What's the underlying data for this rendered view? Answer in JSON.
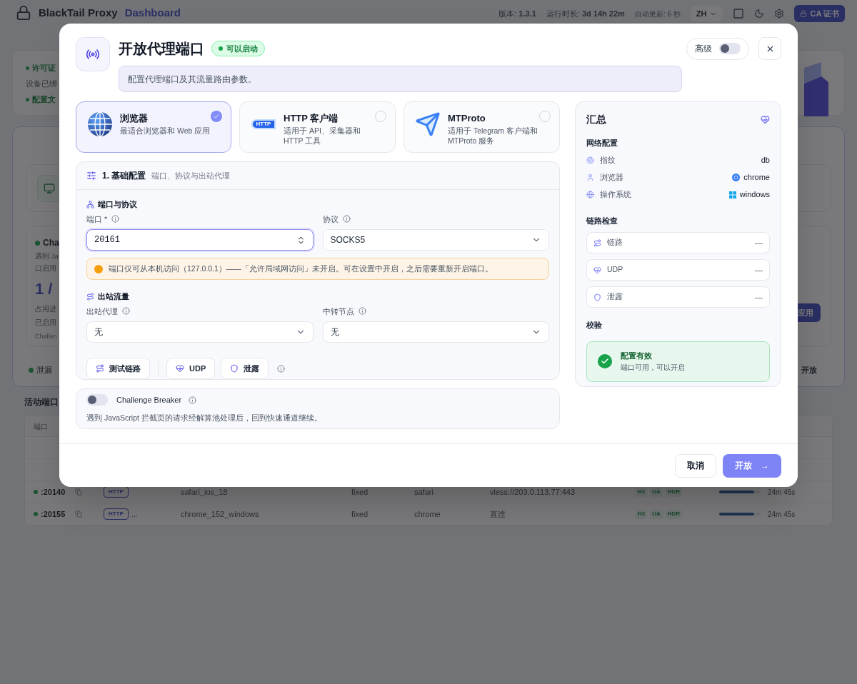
{
  "app_header": {
    "title": "BlackTail Proxy",
    "subtitle": "Dashboard",
    "version": "版本: **1.3.1**",
    "uptime": "运行时长: **3d 14h 22m**",
    "refresh": "自动更新: 6 秒",
    "language": "ZH",
    "cert_button": "CA 证书"
  },
  "background": {
    "notice_lines": [
      {
        "kind": "status",
        "text": "许可证"
      },
      {
        "kind": "plain",
        "text": "设备已绑"
      },
      {
        "kind": "status",
        "text": "配置文"
      }
    ],
    "challenge_title": "Cha",
    "challenge_desc": [
      "遇到 Ja",
      "口启用"
    ],
    "count": "1 /",
    "stats": [
      "占用进",
      "已启用"
    ],
    "footnote": "Challen",
    "apply_button": "应用",
    "leak_label": "泄漏",
    "leak_action": "开放",
    "active_ports": "活动端口"
  },
  "table": {
    "columns": [
      "端口"
    ],
    "rows": [
      {
        "port": ":20140",
        "protocol": "HTTP",
        "extra": "",
        "profile": "safari_ios_18",
        "mode": "fixed",
        "browser": "safari",
        "upstream": "vless://203.0.113.77:443",
        "tags": [
          "H2",
          "UA",
          "HDR"
        ],
        "level": 0.85,
        "time": "24m 45s"
      },
      {
        "port": ":20155",
        "protocol": "HTTP",
        "extra": "...",
        "profile": "chrome_152_windows",
        "mode": "fixed",
        "browser": "chrome",
        "upstream": "直连",
        "tags": [
          "H2",
          "UA",
          "HDR"
        ],
        "level": 0.85,
        "time": "24m 45s"
      }
    ]
  },
  "dialog": {
    "title": "开放代理端口",
    "status_badge": "可以启动",
    "description": "配置代理端口及其流量路由参数。",
    "advanced": {
      "label": "高级",
      "on": false
    },
    "modes": [
      {
        "kind": "browser",
        "title": "浏览器",
        "description": "最适合浏览器和 Web 应用",
        "selected": true
      },
      {
        "kind": "http",
        "icon_text": "HTTP",
        "title": "HTTP 客户端",
        "description": "适用于 API、采集器和 HTTP 工具",
        "selected": false
      },
      {
        "kind": "mtproto",
        "title": "MTProto",
        "description": "适用于 Telegram 客户端和 MTProto 服务",
        "selected": false
      }
    ],
    "basic": {
      "title": "1. 基础配置",
      "subtitle": "端口、协议与出站代理",
      "port_group": "端口与协议",
      "port": {
        "label": "端口 *",
        "value": "20161"
      },
      "protocol": {
        "label": "协议",
        "value": "SOCKS5"
      },
      "warning": "端口仅可从本机访问（127.0.0.1）——「允许局域网访问」未开启。可在设置中开启，之后需要重新开启端口。",
      "outbound_group": "出站流量",
      "outbound_proxy": {
        "label": "出站代理",
        "value": "无"
      },
      "relay": {
        "label": "中转节点",
        "value": "无"
      },
      "actions": [
        {
          "kind": "route",
          "label": "测试链路"
        },
        {
          "kind": "udp",
          "label": "UDP"
        },
        {
          "kind": "leak",
          "label": "泄露"
        }
      ]
    },
    "challenge": {
      "label": "Challenge Breaker",
      "on": false,
      "description": "遇到 JavaScript 拦截页的请求经解算池处理后，回到快速通道继续。"
    },
    "summary": {
      "title": "汇总",
      "network_heading": "网络配置",
      "network": [
        {
          "kind": "fingerprint",
          "label": "指纹",
          "value": "db"
        },
        {
          "kind": "browser",
          "label": "浏览器",
          "value": "chrome"
        },
        {
          "kind": "os",
          "label": "操作系统",
          "value": "windows"
        }
      ],
      "check_heading": "链路检查",
      "checks": [
        {
          "kind": "route",
          "label": "链路",
          "value": "—"
        },
        {
          "kind": "udp",
          "label": "UDP",
          "value": "—"
        },
        {
          "kind": "leak",
          "label": "泄露",
          "value": "—"
        }
      ],
      "validation_heading": "校验",
      "validation": {
        "title": "配置有效",
        "detail": "端口可用，可以开启"
      }
    },
    "footer": {
      "cancel": "取消",
      "submit": "开放",
      "submit_arrow": "→"
    }
  }
}
